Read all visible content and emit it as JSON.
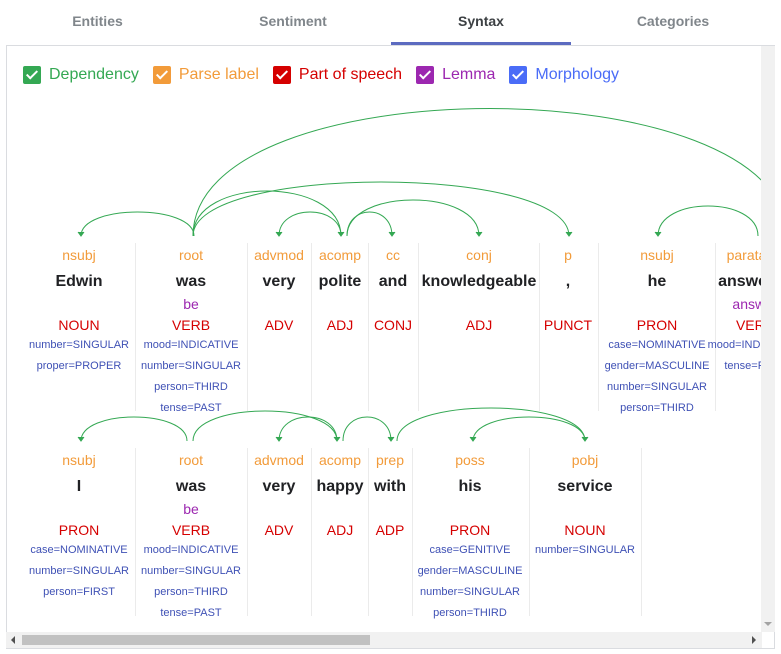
{
  "tabs": [
    {
      "label": "Entities",
      "active": false
    },
    {
      "label": "Sentiment",
      "active": false
    },
    {
      "label": "Syntax",
      "active": true
    },
    {
      "label": "Categories",
      "active": false
    }
  ],
  "legend": [
    {
      "label": "Dependency",
      "color": "#34a853",
      "checked": true
    },
    {
      "label": "Parse label",
      "color": "#f29b3a",
      "checked": true
    },
    {
      "label": "Part of speech",
      "color": "#d50000",
      "checked": true
    },
    {
      "label": "Lemma",
      "color": "#9c27b0",
      "checked": true
    },
    {
      "label": "Morphology",
      "color": "#3f51b5",
      "checked": true
    }
  ],
  "colors": {
    "arc": "#34a853",
    "parse_label": "#f29b3a",
    "pos": "#d50000",
    "lemma": "#9c27b0",
    "morphology": "#3f51b5",
    "tab_underline": "#5c6bc0"
  },
  "sentences": [
    {
      "tokens": [
        {
          "label": "nsubj",
          "word": "Edwin",
          "lemma": "",
          "pos": "NOUN",
          "morph": [
            "number=SINGULAR",
            "proper=PROPER"
          ]
        },
        {
          "label": "root",
          "word": "was",
          "lemma": "be",
          "pos": "VERB",
          "morph": [
            "mood=INDICATIVE",
            "number=SINGULAR",
            "person=THIRD",
            "tense=PAST"
          ]
        },
        {
          "label": "advmod",
          "word": "very",
          "lemma": "",
          "pos": "ADV",
          "morph": []
        },
        {
          "label": "acomp",
          "word": "polite",
          "lemma": "",
          "pos": "ADJ",
          "morph": []
        },
        {
          "label": "cc",
          "word": "and",
          "lemma": "",
          "pos": "CONJ",
          "morph": []
        },
        {
          "label": "conj",
          "word": "knowledgeable",
          "lemma": "",
          "pos": "ADJ",
          "morph": []
        },
        {
          "label": "p",
          "word": ",",
          "lemma": "",
          "pos": "PUNCT",
          "morph": []
        },
        {
          "label": "nsubj",
          "word": "he",
          "lemma": "",
          "pos": "PRON",
          "morph": [
            "case=NOMINATIVE",
            "gender=MASCULINE",
            "number=SINGULAR",
            "person=THIRD"
          ]
        },
        {
          "label": "parataxis",
          "word": "answered",
          "lemma": "answer",
          "pos": "VERB",
          "morph": [
            "mood=INDICATIVE",
            "tense=PAST"
          ]
        }
      ]
    },
    {
      "tokens": [
        {
          "label": "nsubj",
          "word": "I",
          "lemma": "",
          "pos": "PRON",
          "morph": [
            "case=NOMINATIVE",
            "number=SINGULAR",
            "person=FIRST"
          ]
        },
        {
          "label": "root",
          "word": "was",
          "lemma": "be",
          "pos": "VERB",
          "morph": [
            "mood=INDICATIVE",
            "number=SINGULAR",
            "person=THIRD",
            "tense=PAST"
          ]
        },
        {
          "label": "advmod",
          "word": "very",
          "lemma": "",
          "pos": "ADV",
          "morph": []
        },
        {
          "label": "acomp",
          "word": "happy",
          "lemma": "",
          "pos": "ADJ",
          "morph": []
        },
        {
          "label": "prep",
          "word": "with",
          "lemma": "",
          "pos": "ADP",
          "morph": []
        },
        {
          "label": "poss",
          "word": "his",
          "lemma": "",
          "pos": "PRON",
          "morph": [
            "case=GENITIVE",
            "gender=MASCULINE",
            "number=SINGULAR",
            "person=THIRD"
          ]
        },
        {
          "label": "pobj",
          "word": "service",
          "lemma": "",
          "pos": "NOUN",
          "morph": [
            "number=SINGULAR"
          ]
        }
      ]
    }
  ]
}
